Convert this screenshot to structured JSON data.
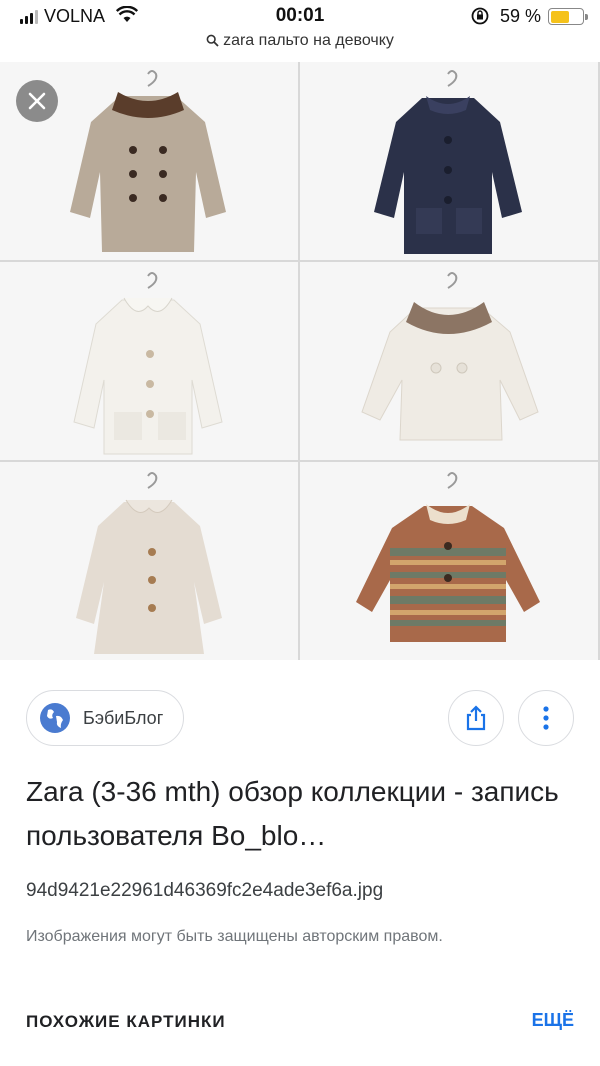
{
  "status_bar": {
    "carrier": "VOLNA",
    "time": "00:01",
    "battery_percent": "59 %",
    "battery_level": 0.59,
    "battery_color": "#f5c21b"
  },
  "search": {
    "query": "zara пальто на девочку"
  },
  "grid": {
    "items": [
      {
        "name": "coat-tweed-fur-collar",
        "color": "#b5a796"
      },
      {
        "name": "coat-navy",
        "color": "#2a3048"
      },
      {
        "name": "coat-white-round-collar",
        "color": "#f1efea"
      },
      {
        "name": "coat-white-fur-collar",
        "color": "#efebe4"
      },
      {
        "name": "coat-beige",
        "color": "#e4dcd3"
      },
      {
        "name": "coat-striped-knit",
        "color": "#a8694a"
      }
    ]
  },
  "result": {
    "source_name": "БэбиБлог",
    "title": "Zara (3-36 mth) обзор коллекции - запись пользователя Bo_blo…",
    "filename": "94d9421e22961d46369fc2e4ade3ef6a.jpg",
    "copyright_notice": "Изображения могут быть защищены авторским правом."
  },
  "similar": {
    "label": "ПОХОЖИЕ КАРТИНКИ",
    "more_label": "ЕЩЁ"
  },
  "colors": {
    "accent": "#1a73e8"
  }
}
